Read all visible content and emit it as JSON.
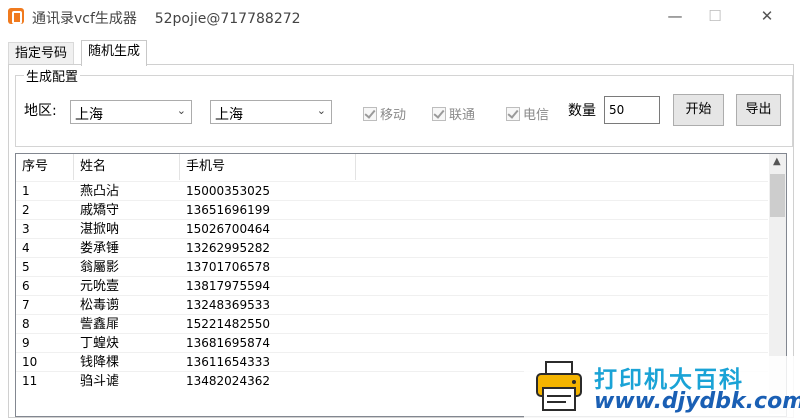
{
  "window": {
    "title": "通讯录vcf生成器    52pojie@717788272",
    "min": "—",
    "max": "☐",
    "close": "✕"
  },
  "tabs": [
    {
      "label": "指定号码",
      "active": false
    },
    {
      "label": "随机生成",
      "active": true
    }
  ],
  "config": {
    "group_title": "生成配置",
    "region_label": "地区:",
    "province": "上海",
    "city": "上海",
    "carriers": [
      {
        "label": "移动",
        "checked": true,
        "disabled": true
      },
      {
        "label": "联通",
        "checked": true,
        "disabled": true
      },
      {
        "label": "电信",
        "checked": true,
        "disabled": true
      }
    ],
    "count_label": "数量",
    "count_value": "50",
    "start_button": "开始",
    "export_button": "导出"
  },
  "table": {
    "headers": [
      "序号",
      "姓名",
      "手机号"
    ],
    "rows": [
      {
        "no": "1",
        "name": "燕凸沾",
        "phone": "15000353025"
      },
      {
        "no": "2",
        "name": "戚矯守",
        "phone": "13651696199"
      },
      {
        "no": "3",
        "name": "湛掀呐",
        "phone": "15026700464"
      },
      {
        "no": "4",
        "name": "娄承锤",
        "phone": "13262995282"
      },
      {
        "no": "5",
        "name": "翁屬影",
        "phone": "13701706578"
      },
      {
        "no": "6",
        "name": "元吮壹",
        "phone": "13817975594"
      },
      {
        "no": "7",
        "name": "松毒谫",
        "phone": "13248369533"
      },
      {
        "no": "8",
        "name": "訾鑫屝",
        "phone": "15221482550"
      },
      {
        "no": "9",
        "name": "丁蝗炔",
        "phone": "13681695874"
      },
      {
        "no": "10",
        "name": "钱降棵",
        "phone": "13611654333"
      },
      {
        "no": "11",
        "name": "驺斗谑",
        "phone": "13482024362"
      }
    ]
  },
  "watermark": {
    "text": "打印机大百科",
    "url": "www.djydbk.com"
  },
  "colors": {
    "accent": "#f07a1e",
    "watermark_text": "#1aa3d6",
    "watermark_url": "#1a5fb4"
  }
}
